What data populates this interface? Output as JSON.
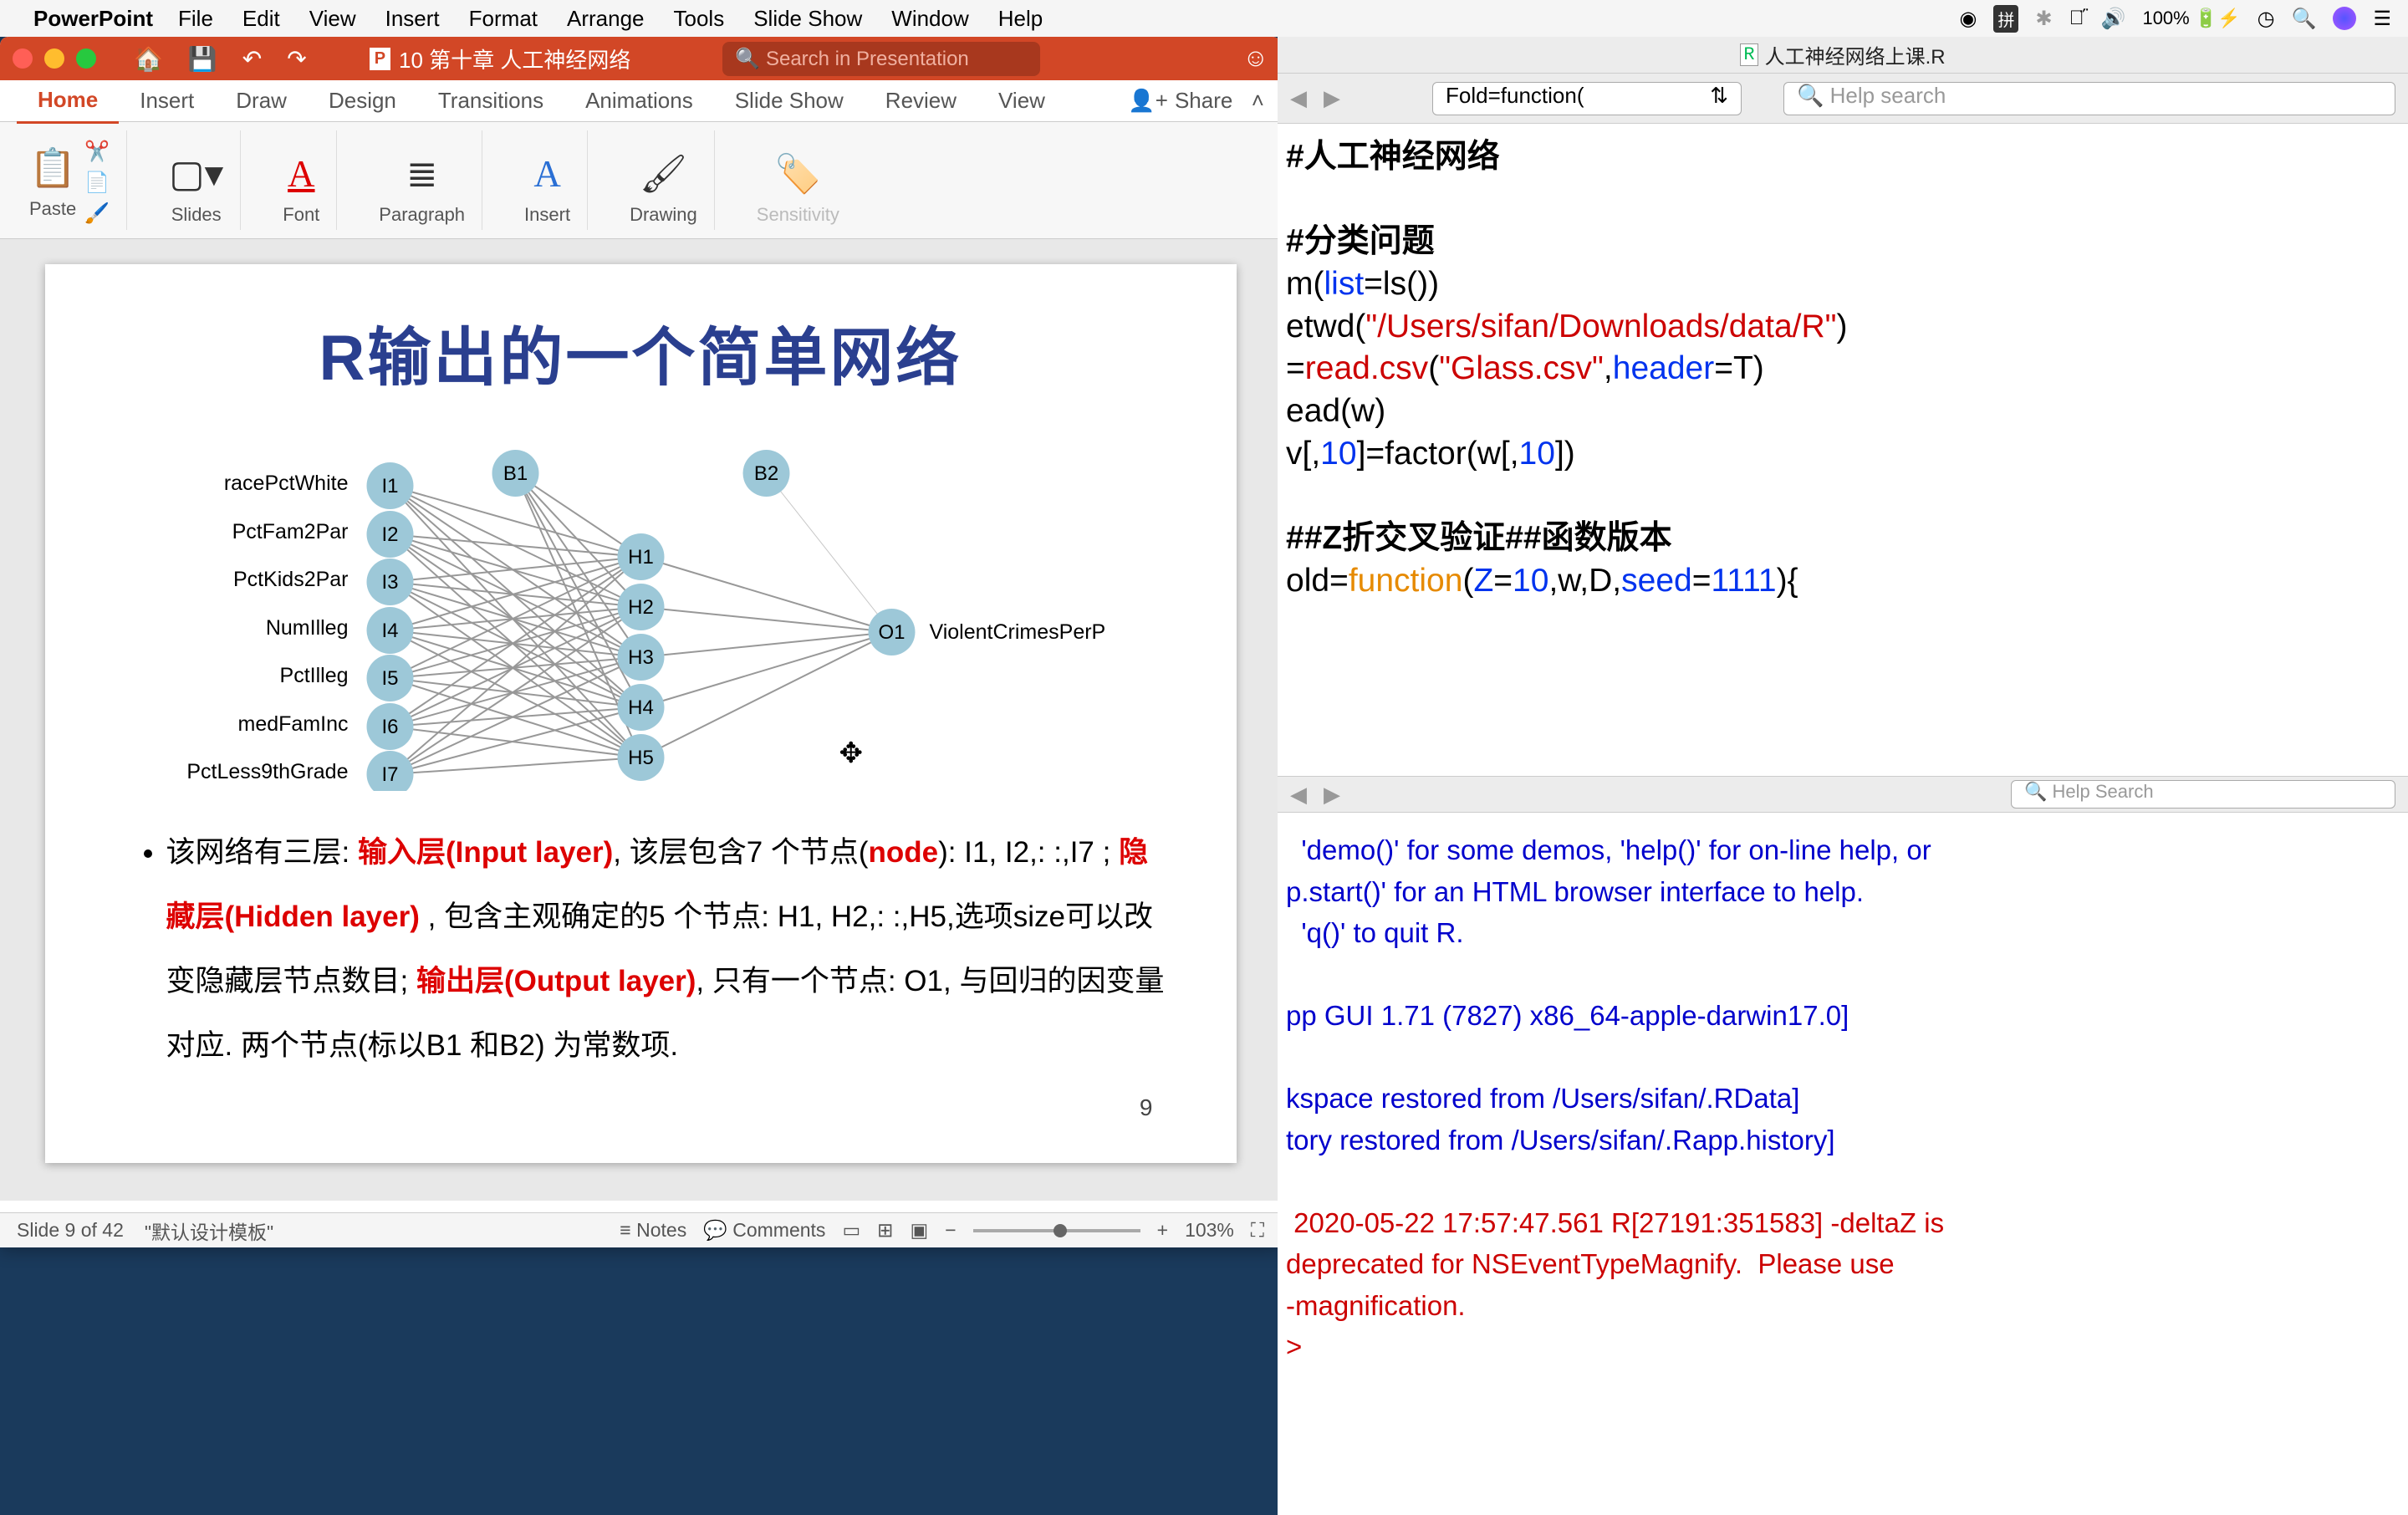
{
  "menubar": {
    "app_name": "PowerPoint",
    "items": [
      "File",
      "Edit",
      "View",
      "Insert",
      "Format",
      "Arrange",
      "Tools",
      "Slide Show",
      "Window",
      "Help"
    ],
    "battery": "100%",
    "input_method": "拼"
  },
  "ppt": {
    "doc_title": "10 第十章 人工神经网络",
    "search_placeholder": "Search in Presentation",
    "tabs": [
      "Home",
      "Insert",
      "Draw",
      "Design",
      "Transitions",
      "Animations",
      "Slide Show",
      "Review",
      "View"
    ],
    "share_label": "Share",
    "ribbon": {
      "paste": "Paste",
      "slides": "Slides",
      "font": "Font",
      "paragraph": "Paragraph",
      "insert": "Insert",
      "drawing": "Drawing",
      "sensitivity": "Sensitivity"
    },
    "slide": {
      "title": "R输出的一个简单网络",
      "inputs": [
        "racePctWhite",
        "PctFam2Par",
        "PctKids2Par",
        "NumIlleg",
        "PctIlleg",
        "medFamInc",
        "PctLess9thGrade"
      ],
      "input_nodes": [
        "I1",
        "I2",
        "I3",
        "I4",
        "I5",
        "I6",
        "I7"
      ],
      "bias_nodes": [
        "B1",
        "B2"
      ],
      "hidden_nodes": [
        "H1",
        "H2",
        "H3",
        "H4",
        "H5"
      ],
      "output_node": "O1",
      "output_label": "ViolentCrimesPerP",
      "bullet1_a": "该网络有三层: ",
      "bullet1_b": "输入层(Input layer)",
      "bullet1_c": ", 该层包含7 个节点(",
      "bullet1_node": "node",
      "bullet1_d": "): I1, I2,: :,I7 ; ",
      "bullet1_e": "隐藏层(Hidden layer)",
      "bullet1_f": " , 包含主观确定的5 个节点: H1, H2,: :,H5,选项size可以改变隐藏层节点数目; ",
      "bullet1_g": "输出层(Output layer)",
      "bullet1_h": ", 只有一个节点: O1, 与回归的因变量对应. 两个节点(标以B1 和B2) 为常数项.",
      "page_num": "9"
    },
    "status": {
      "slide_counter": "Slide 9 of 42",
      "template": "\"默认设计模板\"",
      "notes": "Notes",
      "comments": "Comments",
      "zoom": "103%"
    }
  },
  "rwin": {
    "doc_name": "人工神经网络上课.R",
    "fold_select": "Fold=function(",
    "help_placeholder": "Help search",
    "help_placeholder2": "Help Search",
    "editor": {
      "l1": "#人工神经网络",
      "l2": "#分类问题",
      "l3_a": "m(",
      "l3_b": "list",
      "l3_c": "=ls())",
      "l4_a": "etwd(",
      "l4_b": "\"/Users/sifan/Downloads/data/R\"",
      "l4_c": ")",
      "l5_a": "=",
      "l5_b": "read.csv",
      "l5_c": "(",
      "l5_d": "\"Glass.csv\"",
      "l5_e": ",",
      "l5_f": "header",
      "l5_g": "=T)",
      "l6": "ead(w)",
      "l7_a": "v[,",
      "l7_b": "10",
      "l7_c": "]=factor(w[,",
      "l7_d": "10",
      "l7_e": "])",
      "l8": "##Z折交叉验证##函数版本",
      "l9_a": "old=",
      "l9_b": "function",
      "l9_c": "(",
      "l9_d": "Z",
      "l9_e": "=",
      "l9_f": "10",
      "l9_g": ",w,D,",
      "l9_h": "seed",
      "l9_i": "=",
      "l9_j": "1111",
      "l9_k": "){"
    },
    "console": {
      "l1": "  'demo()' for some demos, 'help()' for on-line help, or",
      "l2": "p.start()' for an HTML browser interface to help.",
      "l3": "  'q()' to quit R.",
      "l4": "pp GUI 1.71 (7827) x86_64-apple-darwin17.0]",
      "l5": "kspace restored from /Users/sifan/.RData]",
      "l6": "tory restored from /Users/sifan/.Rapp.history]",
      "l7": " 2020-05-22 17:57:47.561 R[27191:351583] -deltaZ is",
      "l8": "deprecated for NSEventTypeMagnify.  Please use",
      "l9": "-magnification.",
      "prompt": ">"
    }
  }
}
